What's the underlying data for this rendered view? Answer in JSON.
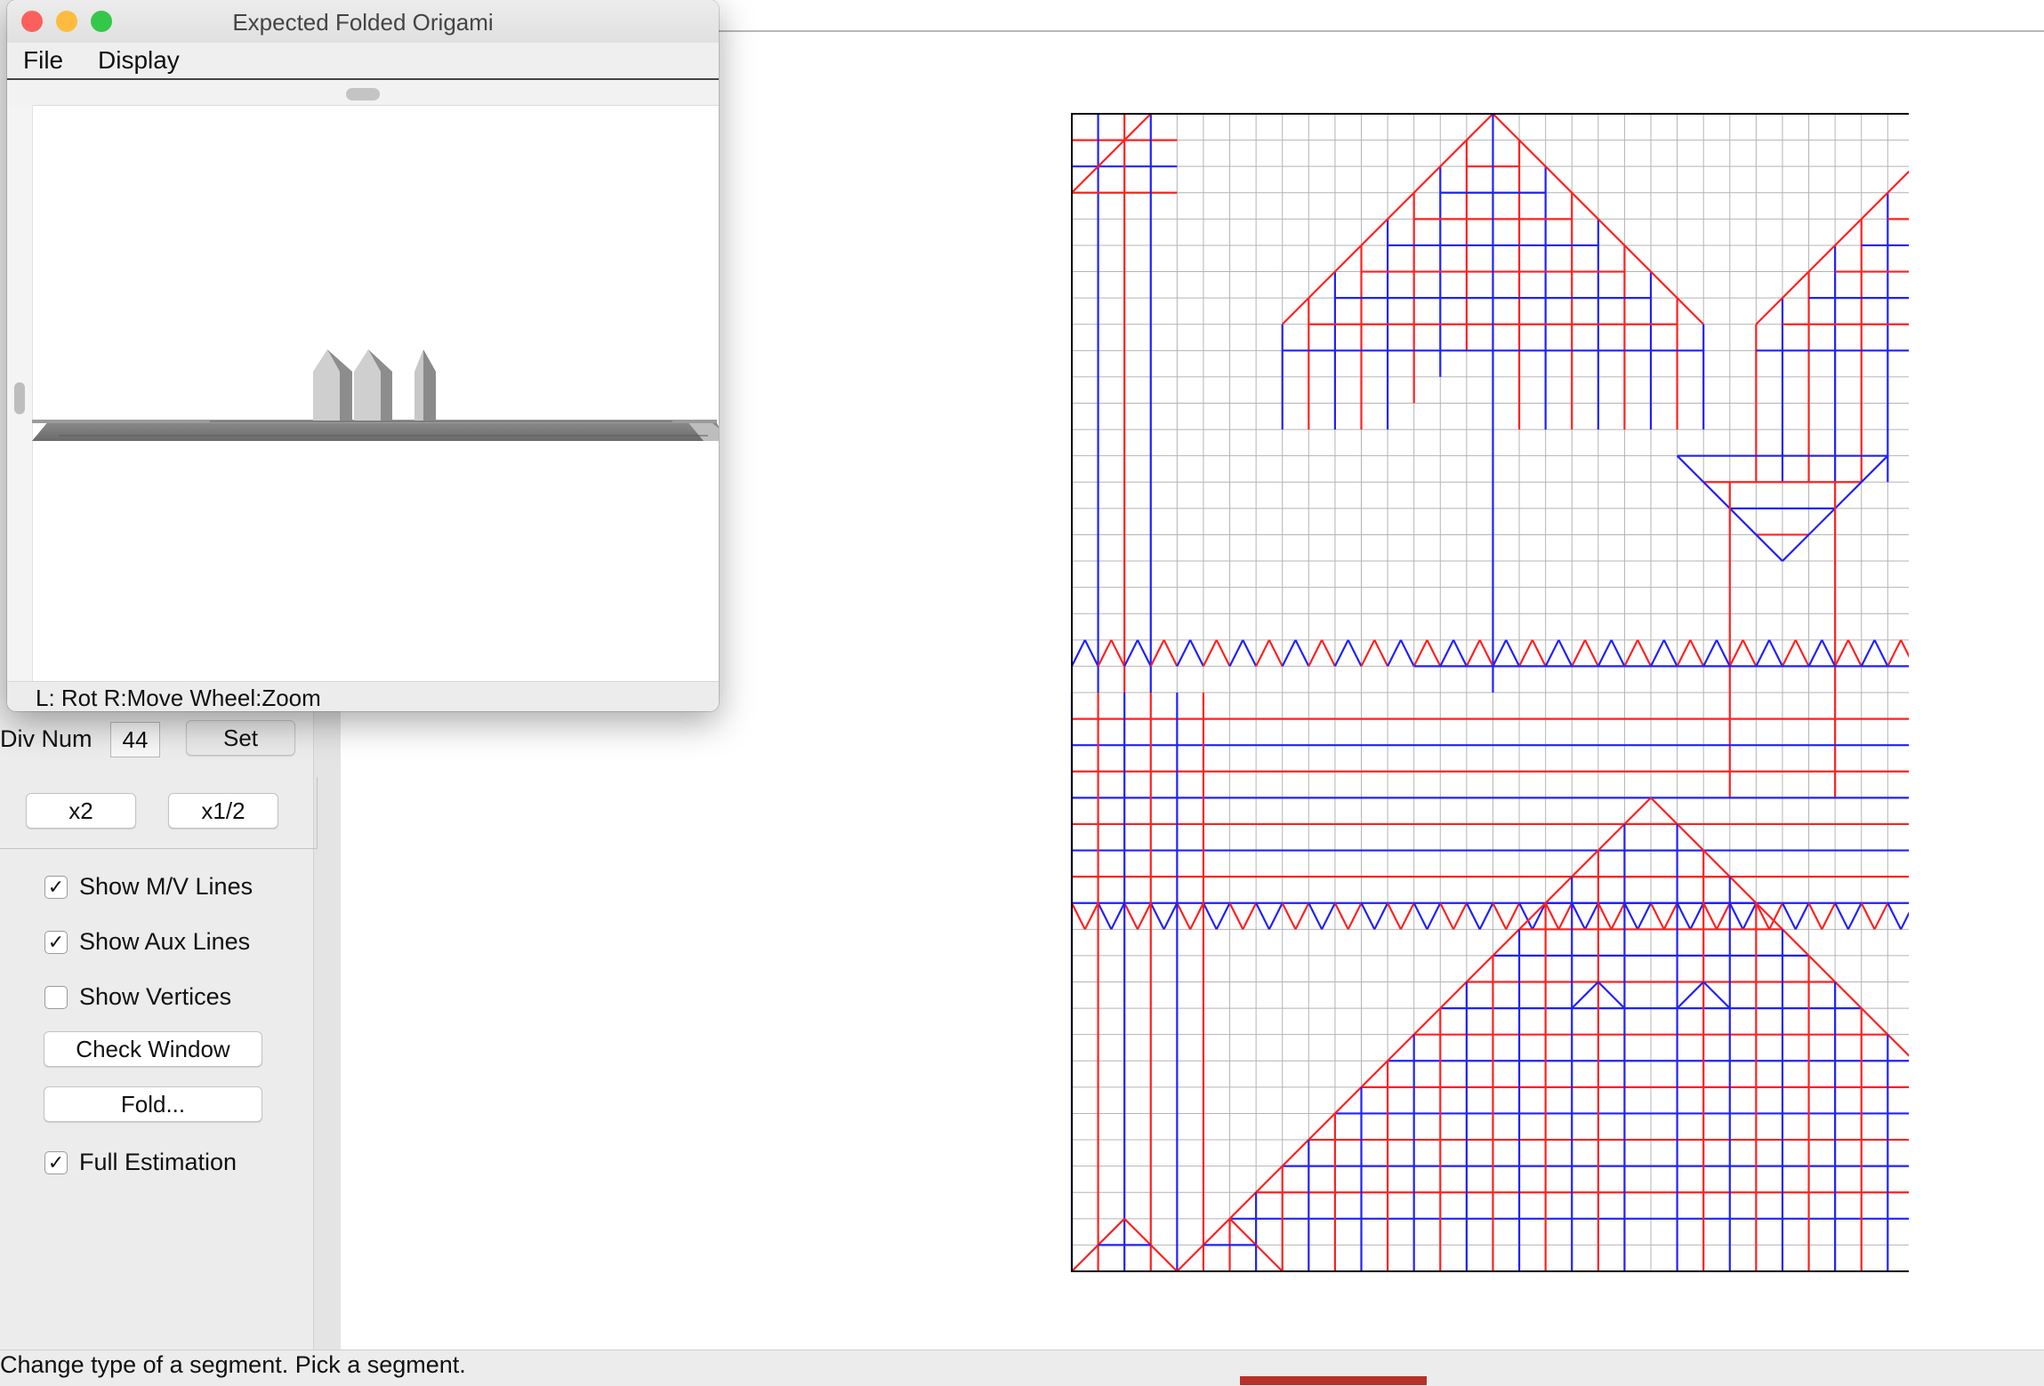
{
  "origami_window": {
    "title": "Expected Folded Origami",
    "menu": [
      "File",
      "Display"
    ],
    "status_hint": "L: Rot R:Move Wheel:Zoom",
    "traffic_lights": {
      "close": "#fc605c",
      "minimize": "#fdbc40",
      "zoom": "#34c84a"
    }
  },
  "left_panel": {
    "div_num_label": "Div Num",
    "div_num_value": "44",
    "set_label": "Set",
    "x2_label": "x2",
    "half_label": "x1/2",
    "check_window_label": "Check Window",
    "fold_label": "Fold...",
    "checkboxes": [
      {
        "label": "Show M/V Lines",
        "checked": true
      },
      {
        "label": "Show Aux Lines",
        "checked": true
      },
      {
        "label": "Show Vertices",
        "checked": false
      },
      {
        "label": "Full Estimation",
        "checked": true
      }
    ]
  },
  "status_bar": {
    "text": "Change type of a segment. Pick a segment."
  },
  "crease_pattern": {
    "grid_divisions": 44,
    "colors": {
      "mountain": "#ff2020",
      "valley": "#2020ff",
      "aux": "#b4b4b4",
      "border": "#000000"
    }
  }
}
